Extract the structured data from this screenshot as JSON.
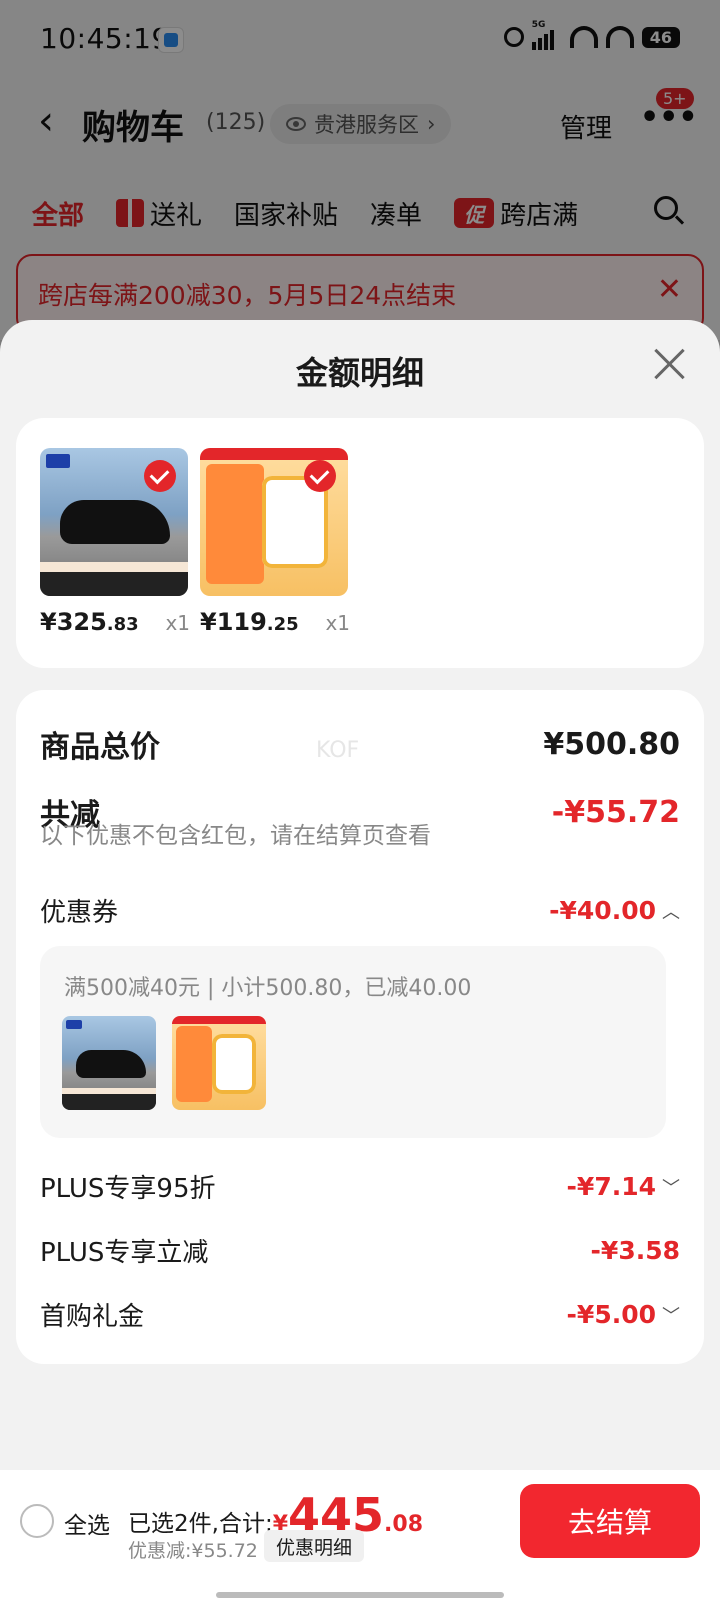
{
  "status_bar": {
    "time": "10:45:19",
    "network": "5G",
    "battery": "46"
  },
  "nav": {
    "title": "购物车",
    "count": "(125)",
    "region": "贵港服务区",
    "manage": "管理",
    "more": "•••",
    "msg_badge": "5+"
  },
  "tabs": [
    {
      "label": "全部",
      "active": true
    },
    {
      "label": "送礼"
    },
    {
      "label": "国家补贴"
    },
    {
      "label": "凑单"
    },
    {
      "label": "跨店满"
    }
  ],
  "promo_icon": "促",
  "promo_banner": {
    "text": "跨店每满200减30，5月5日24点结束"
  },
  "sheet": {
    "title": "金额明细",
    "products": [
      {
        "name": "shoe",
        "price_int": "¥325",
        "price_dec": ".83",
        "qty": "x1"
      },
      {
        "name": "protein-powder",
        "price_int": "¥119",
        "price_dec": ".25",
        "qty": "x1"
      }
    ],
    "watermark": "KOF",
    "total_label": "商品总价",
    "total_value": "¥500.80",
    "reduce_label": "共减",
    "reduce_value": "-¥55.72",
    "reduce_note": "以下优惠不包含红包，请在结算页查看",
    "coupon_label": "优惠券",
    "coupon_value": "-¥40.00",
    "coupon_detail": "满500减40元 | 小计500.80，已减40.00",
    "plus_discount_label": "PLUS专享95折",
    "plus_discount_value": "-¥7.14",
    "plus_instant_label": "PLUS专享立减",
    "plus_instant_value": "-¥3.58",
    "first_gift_label": "首购礼金",
    "first_gift_value": "-¥5.00"
  },
  "bottom_bar": {
    "select_all": "全选",
    "selected_prefix": "已选2件,合计:",
    "total_currency": "¥",
    "total_int": "445",
    "total_dec": ".08",
    "discount": "优惠减:¥55.72",
    "detail_button": "优惠明细",
    "checkout": "去结算"
  },
  "colors": {
    "accent": "#e3262a",
    "checkout": "#f2272f"
  }
}
